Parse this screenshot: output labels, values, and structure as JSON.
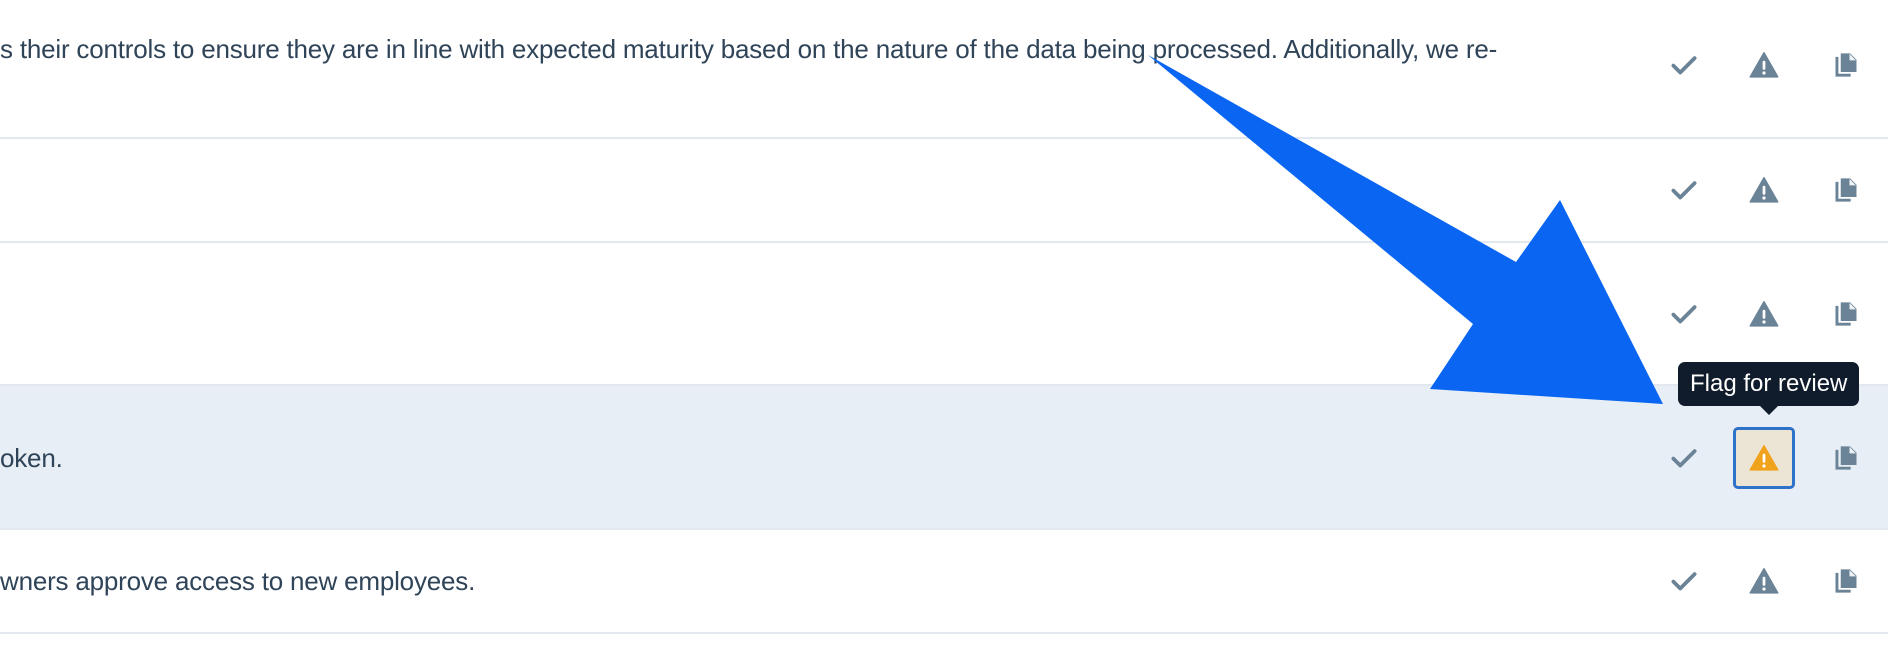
{
  "colors": {
    "text": "#2f4458",
    "icon_muted": "#6b8397",
    "flag_active": "#f0a21c",
    "focus_border": "#2f72c9",
    "row_highlight": "#e8eef5",
    "annotation_arrow": "#0a66f2",
    "tooltip_bg": "#101c2b"
  },
  "rows": [
    {
      "text": "s their controls to ensure they are in line with expected maturity based on the nature of the data being processed. Additionally, we re-"
    },
    {
      "text": ""
    },
    {
      "text": ""
    },
    {
      "text": "oken."
    },
    {
      "text": "wners approve access to new employees."
    }
  ],
  "actions": {
    "approve_icon": "checkmark-icon",
    "flag_icon": "warning-triangle-icon",
    "copy_icon": "copy-document-icon"
  },
  "tooltip": {
    "text": "Flag for review"
  }
}
